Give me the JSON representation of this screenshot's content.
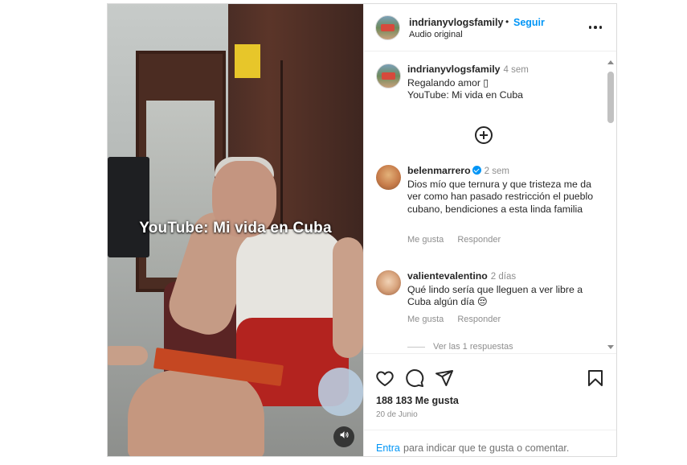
{
  "video": {
    "overlay_caption": "YouTube: Mi vida en Cuba",
    "sound_icon": "speaker-icon"
  },
  "header": {
    "username": "indrianyvlogsfamily",
    "separator": "•",
    "follow_label": "Seguir",
    "audio_label": "Audio original",
    "more_icon": "more-options-icon"
  },
  "caption": {
    "username": "indrianyvlogsfamily",
    "time": "4 sem",
    "line1": "Regalando amor ▯",
    "line2": "YouTube: Mi vida en Cuba",
    "load_more_icon": "plus-circle-icon"
  },
  "comments": [
    {
      "username": "belenmarrero",
      "verified": true,
      "time": "2 sem",
      "text": "Dios mío que ternura y que tristeza me da ver como han pasado restricción el pueblo cubano, bendiciones a esta linda familia",
      "like_label": "Me gusta",
      "reply_label": "Responder"
    },
    {
      "username": "valientevalentino",
      "verified": false,
      "time": "2 días",
      "text": "Qué lindo sería que lleguen a ver libre a Cuba algún día 😔",
      "like_label": "Me gusta",
      "reply_label": "Responder",
      "view_replies": "Ver las 1 respuestas"
    }
  ],
  "actions": {
    "like_icon": "heart-icon",
    "comment_icon": "comment-icon",
    "share_icon": "send-icon",
    "save_icon": "bookmark-icon",
    "likes_count": "188 183 Me gusta",
    "date": "20 de Junio"
  },
  "add_comment": {
    "login_link": "Entra",
    "prompt": "para indicar que te gusta o comentar."
  },
  "colors": {
    "accent": "#0095f6",
    "muted_text": "#8e8e8e",
    "border": "#dbdbdb"
  }
}
